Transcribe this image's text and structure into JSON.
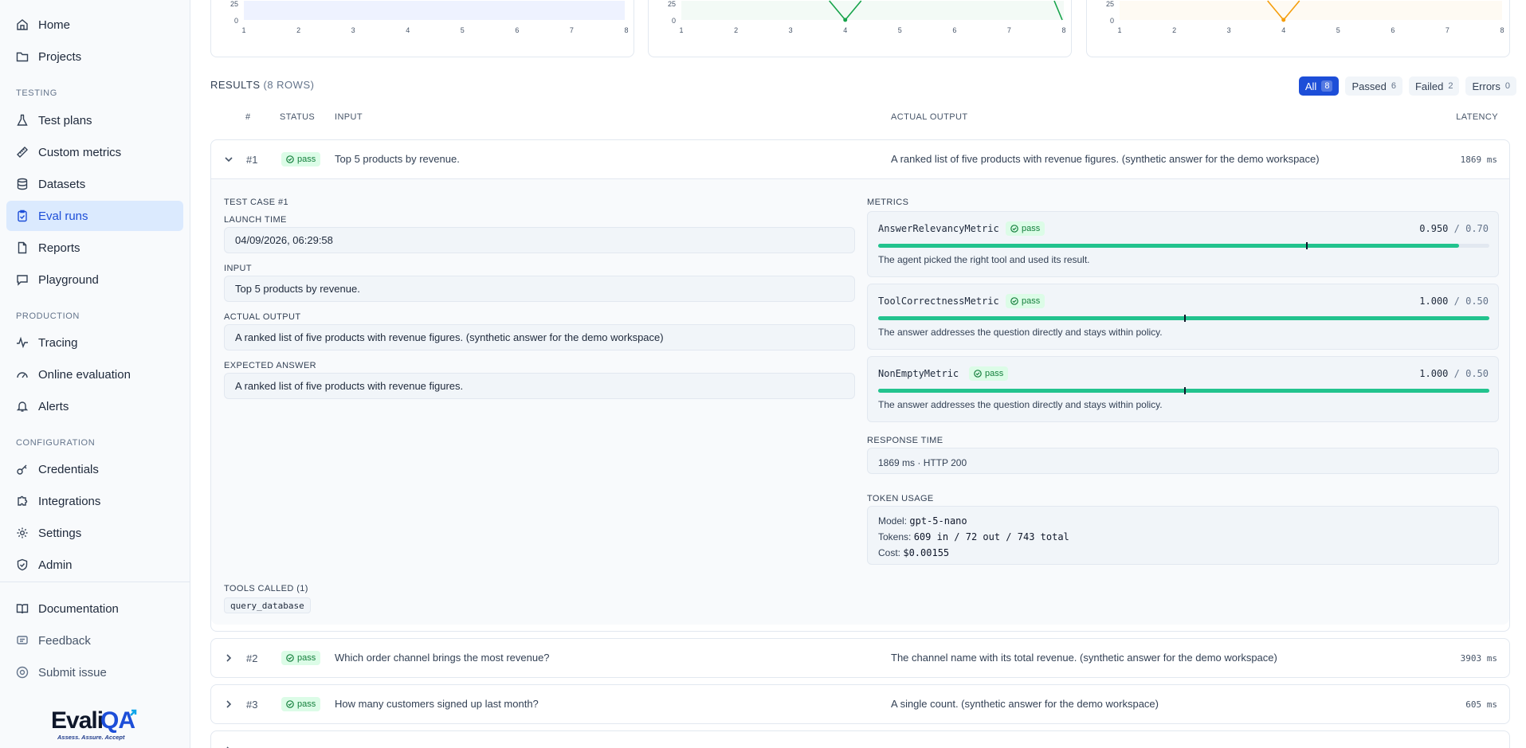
{
  "sidebar": {
    "items_top": [
      {
        "label": "Home",
        "icon": "home-icon"
      },
      {
        "label": "Projects",
        "icon": "folder-icon"
      }
    ],
    "sections": [
      {
        "title": "TESTING",
        "items": [
          {
            "label": "Test plans",
            "icon": "flask-icon"
          },
          {
            "label": "Custom metrics",
            "icon": "ruler-icon"
          },
          {
            "label": "Datasets",
            "icon": "database-icon"
          },
          {
            "label": "Eval runs",
            "icon": "clipboard-check-icon",
            "active": true
          },
          {
            "label": "Reports",
            "icon": "file-icon"
          },
          {
            "label": "Playground",
            "icon": "chat-icon"
          }
        ]
      },
      {
        "title": "PRODUCTION",
        "items": [
          {
            "label": "Tracing",
            "icon": "activity-icon"
          },
          {
            "label": "Online evaluation",
            "icon": "gauge-icon"
          },
          {
            "label": "Alerts",
            "icon": "bell-icon"
          }
        ]
      },
      {
        "title": "CONFIGURATION",
        "items": [
          {
            "label": "Credentials",
            "icon": "key-icon"
          },
          {
            "label": "Integrations",
            "icon": "puzzle-icon"
          },
          {
            "label": "Settings",
            "icon": "gear-icon"
          },
          {
            "label": "Admin",
            "icon": "shield-icon"
          }
        ]
      }
    ],
    "footer": [
      {
        "label": "Documentation",
        "icon": "book-icon"
      },
      {
        "label": "Feedback",
        "icon": "message-icon"
      },
      {
        "label": "Submit issue",
        "icon": "help-icon"
      }
    ],
    "logo": {
      "name": "EvaliQA",
      "tagline": "Assess. Assure. Accept"
    }
  },
  "charts": {
    "x_ticks": [
      "1",
      "2",
      "3",
      "4",
      "5",
      "6",
      "7",
      "8"
    ],
    "y_ticks": [
      "25",
      "0"
    ],
    "colors": [
      "#6366f1",
      "#16a34a",
      "#f59e0b"
    ]
  },
  "results": {
    "title": "RESULTS",
    "count": "(8 ROWS)",
    "filters": [
      {
        "label": "All",
        "count": "8",
        "active": true
      },
      {
        "label": "Passed",
        "count": "6"
      },
      {
        "label": "Failed",
        "count": "2"
      },
      {
        "label": "Errors",
        "count": "0"
      }
    ],
    "columns": {
      "num": "#",
      "status": "STATUS",
      "input": "INPUT",
      "output": "ACTUAL OUTPUT",
      "latency": "LATENCY"
    },
    "rows": [
      {
        "num": "#1",
        "status": "pass",
        "input": "Top 5 products by revenue.",
        "output": "A ranked list of five products with revenue figures. (synthetic answer for the demo workspace)",
        "latency": "1869 ms"
      },
      {
        "num": "#2",
        "status": "pass",
        "input": "Which order channel brings the most revenue?",
        "output": "The channel name with its total revenue. (synthetic answer for the demo workspace)",
        "latency": "3903 ms"
      },
      {
        "num": "#3",
        "status": "pass",
        "input": "How many customers signed up last month?",
        "output": "A single count. (synthetic answer for the demo workspace)",
        "latency": "605 ms"
      }
    ]
  },
  "detail": {
    "title": "TEST CASE #1",
    "launch_time_label": "LAUNCH TIME",
    "launch_time": "04/09/2026, 06:29:58",
    "input_label": "INPUT",
    "input": "Top 5 products by revenue.",
    "actual_label": "ACTUAL OUTPUT",
    "actual": "A ranked list of five products with revenue figures. (synthetic answer for the demo workspace)",
    "expected_label": "EXPECTED ANSWER",
    "expected": "A ranked list of five products with revenue figures.",
    "tools_label": "TOOLS CALLED (1)",
    "tools": [
      "query_database"
    ],
    "metrics_label": "METRICS",
    "metrics": [
      {
        "name": "AnswerRelevancyMetric",
        "status": "pass",
        "score": "0.950",
        "threshold": "/ 0.70",
        "score_value": 0.95,
        "threshold_value": 0.7,
        "reason": "The agent picked the right tool and used its result."
      },
      {
        "name": "ToolCorrectnessMetric",
        "status": "pass",
        "score": "1.000",
        "threshold": "/ 0.50",
        "score_value": 1.0,
        "threshold_value": 0.5,
        "reason": "The answer addresses the question directly and stays within policy."
      },
      {
        "name": "NonEmptyMetric",
        "status": "pass",
        "score": "1.000",
        "threshold": "/ 0.50",
        "score_value": 1.0,
        "threshold_value": 0.5,
        "reason": "The answer addresses the question directly and stays within policy."
      }
    ],
    "response_time_label": "RESPONSE TIME",
    "response_time": "1869 ms · HTTP 200",
    "token_usage_label": "TOKEN USAGE",
    "model_label": "Model:",
    "model": "gpt-5-nano",
    "tokens_label": "Tokens:",
    "tokens": "609 in / 72 out / 743 total",
    "cost_label": "Cost:",
    "cost": "$0.00155"
  }
}
